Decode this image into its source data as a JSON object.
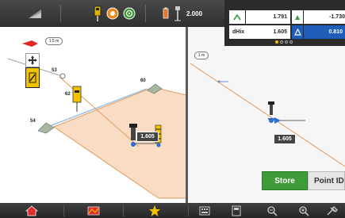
{
  "topbar": {
    "distance_value": "2.000"
  },
  "overlay": {
    "row1": {
      "value_a": "1.791",
      "value_b": "-1.730"
    },
    "row2": {
      "label": "dHix",
      "value_a": "1.605",
      "value_b": "0.810"
    },
    "page_indicator": {
      "pages": 4,
      "active": 1
    }
  },
  "left_view": {
    "scale_label": "1.5 m",
    "points": [
      {
        "id": "53",
        "label": "53"
      },
      {
        "id": "60",
        "label": "60"
      },
      {
        "id": "62",
        "label": "62"
      },
      {
        "id": "54",
        "label": "54"
      }
    ],
    "height_readout": "1.605"
  },
  "right_view": {
    "scale_label": "1 m",
    "height_readout": "1.605"
  },
  "actions": {
    "store_label": "Store",
    "point_id_label": "Point ID"
  },
  "colors": {
    "accent_green": "#3f9a38",
    "surface_fill": "#f8dcc4",
    "boundary_orange": "#e09a5a",
    "overlay_blue": "#1e5db8",
    "arrow_blue": "#2b6fd6"
  },
  "icons": {
    "topbar": [
      "slope-icon",
      "rover-icon",
      "satellite-icon",
      "target-icon",
      "battery-icon",
      "antenna-height-icon"
    ],
    "bottombar": [
      "home-icon",
      "site-map-icon",
      "favorites-star-icon",
      "keypad-icon",
      "calculator-icon",
      "zoom-out-icon",
      "zoom-in-icon",
      "settings-tools-icon"
    ]
  }
}
